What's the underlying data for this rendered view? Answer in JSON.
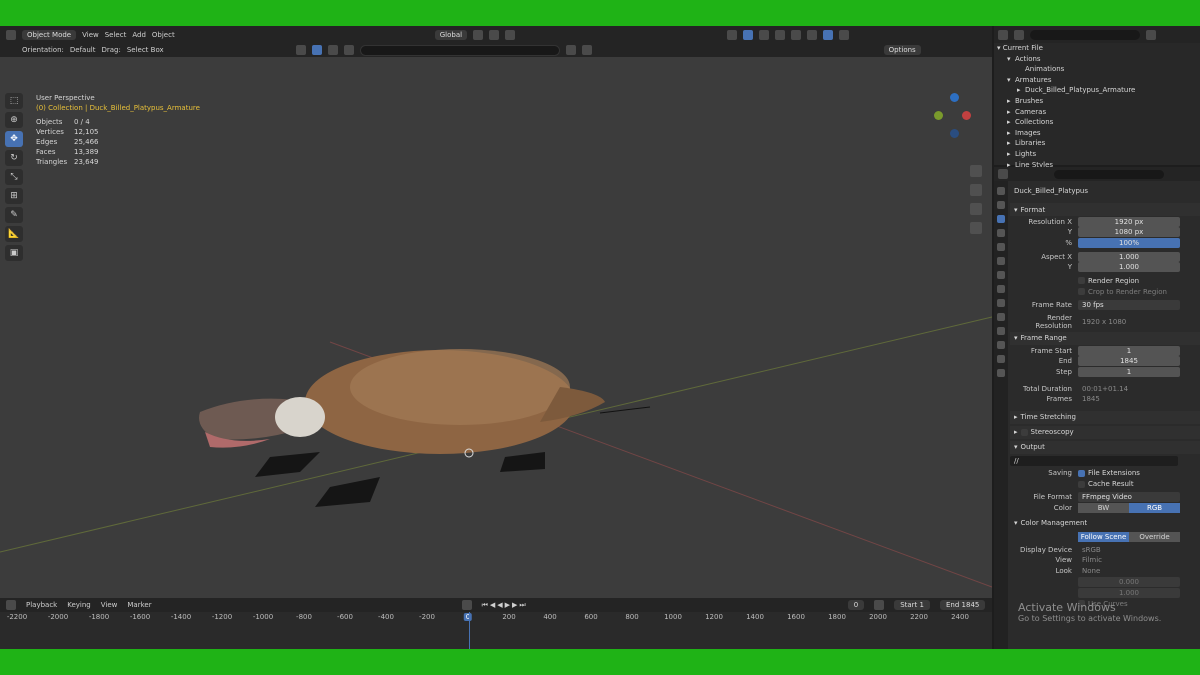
{
  "viewport_header": {
    "mode": "Object Mode",
    "menus": [
      "View",
      "Select",
      "Add",
      "Object"
    ],
    "transform_orientation": "Global"
  },
  "tool_settings": {
    "orientation_label": "Orientation:",
    "orientation_value": "Default",
    "drag_label": "Drag:",
    "drag_value": "Select Box",
    "options_label": "Options"
  },
  "overlay": {
    "perspective": "User Perspective",
    "collection": "(0) Collection | Duck_Billed_Platypus_Armature",
    "stats": [
      {
        "label": "Objects",
        "value": "0 / 4"
      },
      {
        "label": "Vertices",
        "value": "12,105"
      },
      {
        "label": "Edges",
        "value": "25,466"
      },
      {
        "label": "Faces",
        "value": "13,389"
      },
      {
        "label": "Triangles",
        "value": "23,649"
      }
    ]
  },
  "timeline": {
    "menus": [
      "Playback",
      "Keying",
      "View",
      "Marker"
    ],
    "current_frame": "0",
    "start_label": "Start",
    "start_value": "1",
    "end_label": "End",
    "end_value": "1845",
    "ruler": [
      "-2200",
      "-2000",
      "-1800",
      "-1600",
      "-1400",
      "-1200",
      "-1000",
      "-800",
      "-600",
      "-400",
      "-200",
      "0",
      "200",
      "400",
      "600",
      "800",
      "1000",
      "1200",
      "1400",
      "1600",
      "1800",
      "2000",
      "2200",
      "2400"
    ]
  },
  "outliner": {
    "root": "Current File",
    "items": [
      {
        "label": "Actions",
        "level": 1,
        "arrow": "▾"
      },
      {
        "label": "Animations",
        "level": 2,
        "arrow": ""
      },
      {
        "label": "Armatures",
        "level": 1,
        "arrow": "▾"
      },
      {
        "label": "Duck_Billed_Platypus_Armature",
        "level": 2,
        "arrow": "▸"
      },
      {
        "label": "Brushes",
        "level": 1,
        "arrow": "▸"
      },
      {
        "label": "Cameras",
        "level": 1,
        "arrow": "▸"
      },
      {
        "label": "Collections",
        "level": 1,
        "arrow": "▸"
      },
      {
        "label": "Images",
        "level": 1,
        "arrow": "▸"
      },
      {
        "label": "Libraries",
        "level": 1,
        "arrow": "▸"
      },
      {
        "label": "Lights",
        "level": 1,
        "arrow": "▸"
      },
      {
        "label": "Line Styles",
        "level": 1,
        "arrow": "▸"
      }
    ]
  },
  "properties": {
    "object_name": "Duck_Billed_Platypus",
    "format": {
      "title": "Format",
      "res_x_label": "Resolution X",
      "res_x": "1920 px",
      "res_y_label": "Y",
      "res_y": "1080 px",
      "pct_label": "%",
      "pct": "100%",
      "aspect_x_label": "Aspect X",
      "aspect_x": "1.000",
      "aspect_y_label": "Y",
      "aspect_y": "1.000",
      "render_region": "Render Region",
      "crop": "Crop to Render Region",
      "frame_rate_label": "Frame Rate",
      "frame_rate": "30 fps",
      "render_res_label": "Render Resolution",
      "render_res": "1920 x 1080"
    },
    "frame_range": {
      "title": "Frame Range",
      "start_label": "Frame Start",
      "start": "1",
      "end_label": "End",
      "end": "1845",
      "step_label": "Step",
      "step": "1",
      "duration_label": "Total Duration",
      "duration": "00:01+01.14",
      "frames_label": "Frames",
      "frames": "1845"
    },
    "time_stretching": "Time Stretching",
    "stereoscopy": "Stereoscopy",
    "output": {
      "title": "Output",
      "path": "//",
      "saving_label": "Saving",
      "file_extensions": "File Extensions",
      "cache_result": "Cache Result",
      "file_format_label": "File Format",
      "file_format": "FFmpeg Video",
      "color_label": "Color",
      "color_bw": "BW",
      "color_rgb": "RGB"
    },
    "color_management": {
      "title": "Color Management",
      "follow_scene": "Follow Scene",
      "override": "Override",
      "display_device_label": "Display Device",
      "display_device": "sRGB",
      "view_label": "View",
      "view": "Filmic",
      "look_label": "Look",
      "look": "None",
      "exposure": "0.000",
      "gamma": "1.000",
      "use_curves": "Use Curves"
    }
  },
  "watermark": {
    "title": "Activate Windows",
    "subtitle": "Go to Settings to activate Windows."
  },
  "colors": {
    "accent": "#4772b3",
    "bg": "#3c3c3c",
    "green_screen": "#1fb316"
  }
}
